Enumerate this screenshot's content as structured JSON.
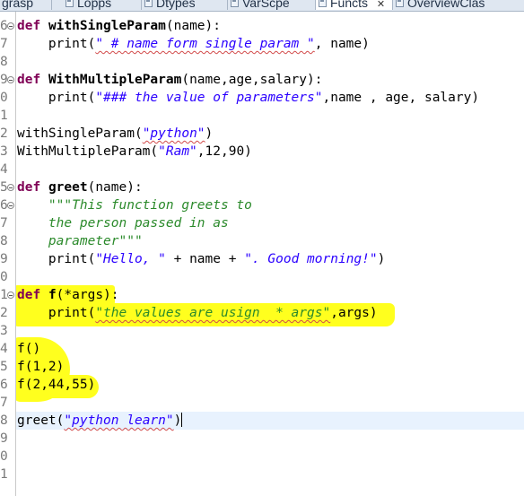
{
  "tabs": [
    {
      "label": "grasp",
      "active": false
    },
    {
      "label": "Lopps",
      "active": false
    },
    {
      "label": "Dtypes",
      "active": false
    },
    {
      "label": "VarScpe",
      "active": false
    },
    {
      "label": "Functs",
      "active": true
    },
    {
      "label": "OverviewClas",
      "active": false
    }
  ],
  "tab_close_glyph": "✕",
  "line_numbers": [
    "6",
    "7",
    "8",
    "9",
    "0",
    "1",
    "2",
    "3",
    "4",
    "5",
    "6",
    "7",
    "8",
    "9",
    "0",
    "1",
    "2",
    "3",
    "4",
    "5",
    "6",
    "7",
    "8",
    "9",
    "0",
    "1"
  ],
  "code": {
    "l1_kw": "def",
    "l1_name": "withSingleParam",
    "l1_rest": "(name):",
    "l2_a": "    print(",
    "l2_str": "\" # name form single param \"",
    "l2_b": ", name)",
    "l4_kw": "def",
    "l4_name": "WithMultipleParam",
    "l4_rest": "(name,age,salary):",
    "l5_a": "    print(",
    "l5_str": "\"### the value of parameters\"",
    "l5_b": ",name , age, salary)",
    "l7_a": "withSingleParam(",
    "l7_str": "\"python\"",
    "l7_b": ")",
    "l8_a": "WithMultipleParam(",
    "l8_str": "\"Ram\"",
    "l8_b": ",12,90)",
    "l10_kw": "def",
    "l10_name": "greet",
    "l10_rest": "(name):",
    "l11": "    \"\"\"This function greets to",
    "l12": "    the person passed in as",
    "l13": "    parameter\"\"\"",
    "l14_a": "    print(",
    "l14_str1": "\"Hello, \"",
    "l14_b": " + name + ",
    "l14_str2": "\". Good morning!\"",
    "l14_c": ")",
    "l16_kw": "def",
    "l16_name": "f",
    "l16_rest": "(*args):",
    "l17_a": "    print(",
    "l17_str": "\"the values are usign  * args\"",
    "l17_b": ",args)",
    "l19": "f()",
    "l20": "f(1,2)",
    "l21": "f(2,44,55)",
    "l23_a": "greet(",
    "l23_str": "\"python learn\"",
    "l23_b": ")"
  },
  "colors": {
    "keyword": "#7f0055",
    "string": "#2a00ff",
    "docstring": "#2b8a2b",
    "highlight": "#ffff1e",
    "current_line": "#e8f2fe"
  }
}
